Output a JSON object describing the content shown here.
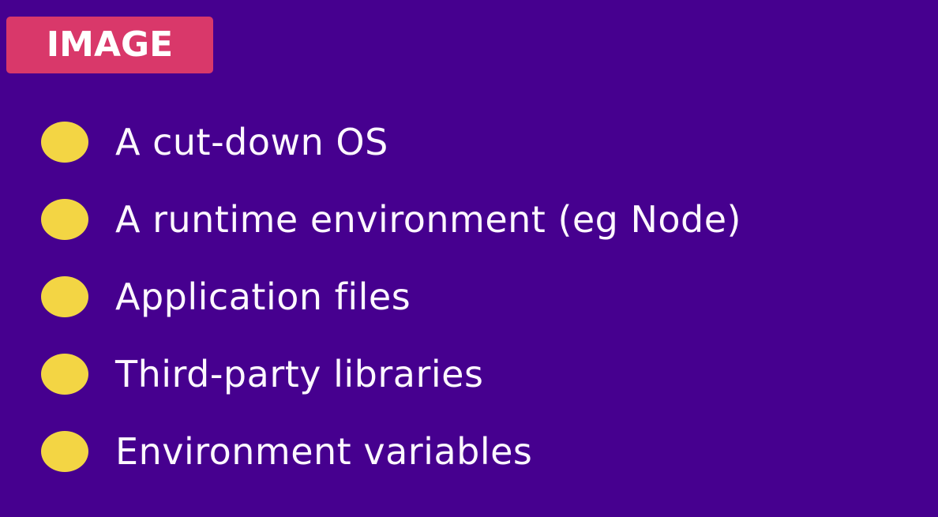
{
  "header": {
    "badge_label": "IMAGE"
  },
  "bullets": [
    {
      "label": "A cut-down OS"
    },
    {
      "label": "A runtime environment  (eg Node)"
    },
    {
      "label": "Application files"
    },
    {
      "label": "Third-party libraries"
    },
    {
      "label": "Environment variables"
    }
  ],
  "colors": {
    "background": "#46008f",
    "badge": "#d9386a",
    "bullet_dot": "#f3d544",
    "text": "#fdf7ff"
  }
}
